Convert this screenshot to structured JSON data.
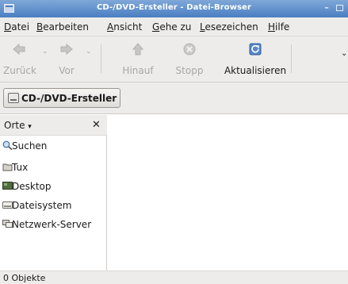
{
  "window": {
    "title": "CD-/DVD-Ersteller - Datei-Browser"
  },
  "menubar": {
    "items": [
      {
        "key": "D",
        "rest": "atei"
      },
      {
        "key": "B",
        "rest": "earbeiten"
      },
      {
        "key": "A",
        "rest": "nsicht"
      },
      {
        "key": "G",
        "rest": "ehe zu"
      },
      {
        "key": "L",
        "rest": "esezeichen"
      },
      {
        "key": "H",
        "rest": "ilfe"
      }
    ]
  },
  "toolbar": {
    "back_label": "Zurück",
    "forward_label": "Vor",
    "up_label": "Hinauf",
    "stop_label": "Stopp",
    "reload_label": "Aktualisieren"
  },
  "location": {
    "button_label": "CD-/DVD-Ersteller"
  },
  "sidebar": {
    "selector_label": "Orte",
    "items": [
      {
        "label": "Suchen",
        "icon": "search-icon"
      },
      {
        "label": "Tux",
        "icon": "home-folder-icon"
      },
      {
        "label": "Desktop",
        "icon": "desktop-icon"
      },
      {
        "label": "Dateisystem",
        "icon": "filesystem-icon"
      },
      {
        "label": "Netzwerk-Server",
        "icon": "network-icon"
      }
    ]
  },
  "status": {
    "text": "0 Objekte"
  },
  "colors": {
    "titlebar": "#4a7ec2",
    "chrome": "#edeceb",
    "disabled_text": "#a9a7a3"
  }
}
